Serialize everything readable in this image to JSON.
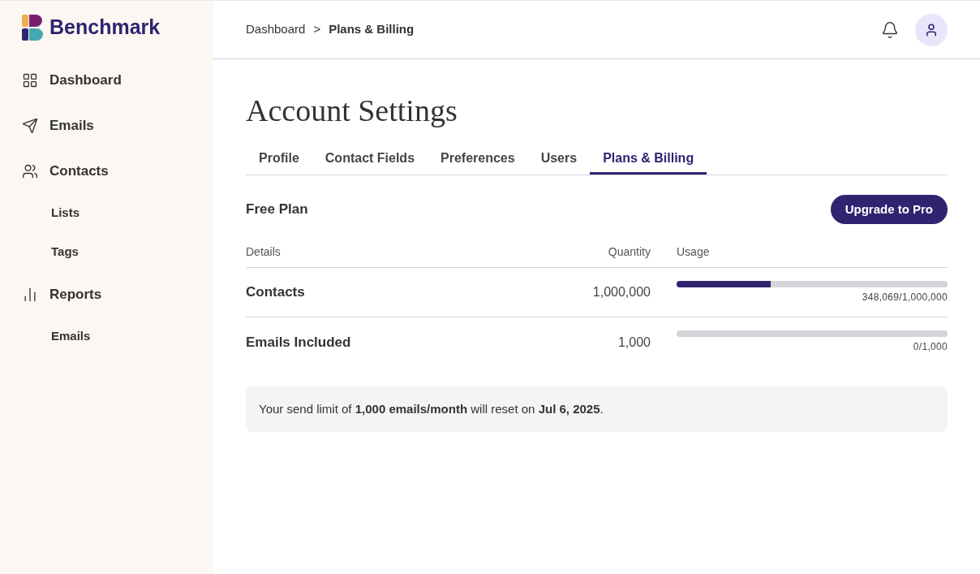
{
  "brand": {
    "name": "Benchmark"
  },
  "sidebar": {
    "items": [
      {
        "label": "Dashboard",
        "kind": "main"
      },
      {
        "label": "Emails",
        "kind": "main"
      },
      {
        "label": "Contacts",
        "kind": "main"
      },
      {
        "label": "Lists",
        "kind": "sub"
      },
      {
        "label": "Tags",
        "kind": "sub"
      },
      {
        "label": "Reports",
        "kind": "main"
      },
      {
        "label": "Emails",
        "kind": "sub"
      }
    ]
  },
  "breadcrumb": {
    "items": [
      "Dashboard",
      "Plans & Billing"
    ],
    "separator": ">"
  },
  "page_title": "Account Settings",
  "tabs": [
    {
      "label": "Profile",
      "selected": false
    },
    {
      "label": "Contact Fields",
      "selected": false
    },
    {
      "label": "Preferences",
      "selected": false
    },
    {
      "label": "Users",
      "selected": false
    },
    {
      "label": "Plans & Billing",
      "selected": true
    }
  ],
  "plan": {
    "name": "Free Plan",
    "button": "Upgrade to Pro"
  },
  "table": {
    "columns": [
      "Details",
      "Quantity",
      "Usage"
    ],
    "rows": [
      {
        "detail": "Contacts",
        "quantity": "1,000,000",
        "level": 0.348,
        "reading": "348,069/1,000,000"
      },
      {
        "detail": "Emails Included",
        "quantity": "1,000",
        "level": 0,
        "reading": "0/1,000"
      }
    ]
  },
  "notice": "Your send limit of **1,000 emails/month** will reset on **Jul 6, 2025**."
}
